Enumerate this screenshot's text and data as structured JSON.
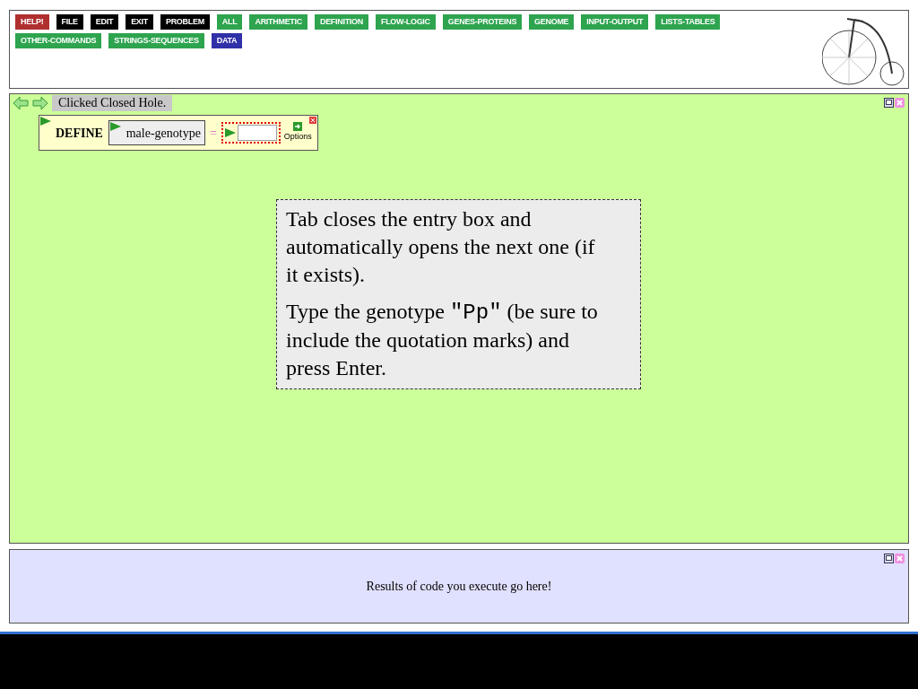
{
  "menu": [
    {
      "label": "HELP!",
      "color": "#b03030"
    },
    {
      "label": "FILE",
      "color": "#000000"
    },
    {
      "label": "EDIT",
      "color": "#000000"
    },
    {
      "label": "EXIT",
      "color": "#000000"
    },
    {
      "label": "PROBLEM",
      "color": "#000000"
    },
    {
      "label": "ALL",
      "color": "#2ea44f"
    },
    {
      "label": "ARITHMETIC",
      "color": "#2ea44f"
    },
    {
      "label": "DEFINITION",
      "color": "#2ea44f"
    },
    {
      "label": "FLOW-LOGIC",
      "color": "#2ea44f"
    },
    {
      "label": "GENES-PROTEINS",
      "color": "#2ea44f"
    },
    {
      "label": "GENOME",
      "color": "#2ea44f"
    },
    {
      "label": "INPUT-OUTPUT",
      "color": "#2ea44f"
    },
    {
      "label": "LISTS-TABLES",
      "color": "#2ea44f"
    },
    {
      "label": "OTHER-COMMANDS",
      "color": "#2ea44f"
    },
    {
      "label": "STRINGS-SEQUENCES",
      "color": "#2ea44f"
    },
    {
      "label": "DATA",
      "color": "#3030a8"
    }
  ],
  "workspace": {
    "status": "Clicked Closed Hole.",
    "define_box": {
      "keyword": "DEFINE",
      "name": "male-genotype",
      "operator": "=",
      "options_label": "Options"
    },
    "hint": [
      [
        {
          "kind": "text",
          "text": "Tab closes the entry box and automatically opens the next one (if it exists)."
        }
      ],
      [
        {
          "kind": "text",
          "text": "Type the genotype "
        },
        {
          "kind": "code",
          "text": "\"Pp\""
        },
        {
          "kind": "text",
          "text": " (be sure to include the quotation marks) and press Enter."
        }
      ]
    ]
  },
  "results": {
    "text": "Results of code you execute go here!"
  }
}
